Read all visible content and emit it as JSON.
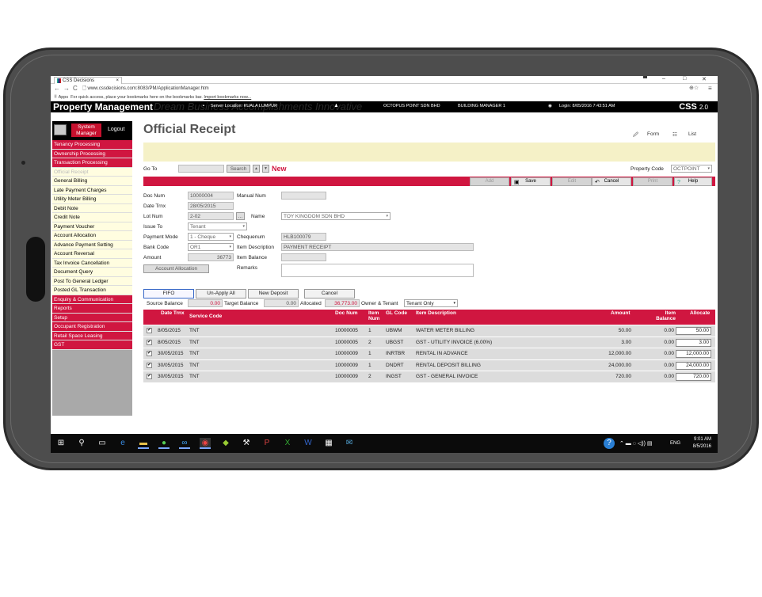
{
  "browser": {
    "tab_title": "CSS Decisions",
    "url": "www.cssdecisions.com:8083/PM/ApplicationManager.htm",
    "bookmarks_apps": "Apps",
    "bookmarks_hint": "For quick access, place your bookmarks here on the bookmarks bar.",
    "bookmarks_link": "Import bookmarks now..."
  },
  "header": {
    "app_title": "Property Management",
    "watermark": "Dream Business Accomplishments Innovative",
    "server_location": "Server Location: KUALA LUMPUR",
    "company": "OCTOPUS POINT SDN BHD",
    "role": "BUILDING MANAGER 1",
    "login": "Login: 8/05/2016 7:43:51 AM",
    "brand": "CSS",
    "version": "2.0"
  },
  "sidebar": {
    "system_manager": "System Manager",
    "logout": "Logout",
    "items": [
      {
        "label": "Tenancy Processing",
        "style": "red"
      },
      {
        "label": "Ownership Processing",
        "style": "red"
      },
      {
        "label": "Transaction Processing",
        "style": "red"
      },
      {
        "label": "Official Receipt",
        "style": "active"
      },
      {
        "label": "General Billing",
        "style": "light"
      },
      {
        "label": "Late Payment Charges",
        "style": "light"
      },
      {
        "label": "Utility Meter Billing",
        "style": "light"
      },
      {
        "label": "Debit Note",
        "style": "light"
      },
      {
        "label": "Credit Note",
        "style": "light"
      },
      {
        "label": "Payment Voucher",
        "style": "light"
      },
      {
        "label": "Account Allocation",
        "style": "light"
      },
      {
        "label": "Advance Payment Setting",
        "style": "light"
      },
      {
        "label": "Account Reversal",
        "style": "light"
      },
      {
        "label": "Tax Invoice Cancellation",
        "style": "light"
      },
      {
        "label": "Document Query",
        "style": "light"
      },
      {
        "label": "Post To General Ledger",
        "style": "light"
      },
      {
        "label": "Posted GL Transaction",
        "style": "light"
      },
      {
        "label": "Enquiry & Communication",
        "style": "red"
      },
      {
        "label": "Reports",
        "style": "red"
      },
      {
        "label": "Setup",
        "style": "red"
      },
      {
        "label": "Occupant Registration",
        "style": "red"
      },
      {
        "label": "Retail Space Leasing",
        "style": "red"
      },
      {
        "label": "GST",
        "style": "red"
      }
    ]
  },
  "page": {
    "title": "Official Receipt",
    "form_link": "Form",
    "list_link": "List",
    "goto_label": "Go To",
    "search_btn": "Search",
    "new_label": "New",
    "property_code_label": "Property Code",
    "property_code": "OCTPOINT"
  },
  "toolbar": {
    "add": "Add",
    "save": "Save",
    "edit": "Edit",
    "cancel": "Cancel",
    "print": "Print",
    "help": "Help"
  },
  "form": {
    "doc_num_label": "Doc Num",
    "doc_num": "10000004",
    "manual_num_label": "Manual Num",
    "manual_num": "",
    "date_label": "Date Trnx",
    "date": "28/05/2015",
    "lot_label": "Lot Num",
    "lot": "2-02",
    "lot_btn": "...",
    "name_label": "Name",
    "name": "TOY KINGDOM SDN BHD",
    "issue_label": "Issue To",
    "issue": "Tenant",
    "mode_label": "Payment Mode",
    "mode": "1 - Cheque",
    "cheque_label": "Chequenum",
    "cheque": "HLB100079",
    "bank_label": "Bank Code",
    "bank": "OR1",
    "desc_label": "Item Description",
    "desc": "PAYMENT RECEIPT",
    "amount_label": "Amount",
    "amount": "36773",
    "balance_label": "Item Balance",
    "balance": "",
    "remarks_label": "Remarks",
    "remarks": "",
    "alloc_btn": "Account Allocation"
  },
  "grid": {
    "fifo": "FIFO",
    "unapply": "Un-Apply All",
    "new_deposit": "New Deposit",
    "cancel": "Cancel",
    "source_label": "Source Balance",
    "source": "0.00",
    "target_label": "Target Balance",
    "target": "0.00",
    "allocated_label": "Allocated",
    "allocated": "36,773.00",
    "owner_label": "Owner & Tenant",
    "owner": "Tenant Only",
    "headers": {
      "date": "Date Trnx",
      "service": "Service Code",
      "doc": "Doc Num",
      "item": "Item Num",
      "gl": "GL Code",
      "desc": "Item Description",
      "amount": "Amount",
      "balance": "Item Balance",
      "alloc": "Allocate"
    },
    "rows": [
      {
        "date": "8/05/2015",
        "service": "TNT",
        "doc": "10000005",
        "item": "1",
        "gl": "UBWM",
        "desc": "WATER METER BILLING",
        "amount": "50.00",
        "balance": "0.00",
        "alloc": "50.00"
      },
      {
        "date": "8/05/2015",
        "service": "TNT",
        "doc": "10000005",
        "item": "2",
        "gl": "UBGST",
        "desc": "GST - UTILITY INVOICE (6.00%)",
        "amount": "3.00",
        "balance": "0.00",
        "alloc": "3.00"
      },
      {
        "date": "30/05/2015",
        "service": "TNT",
        "doc": "10000009",
        "item": "1",
        "gl": "INRTBR",
        "desc": "RENTAL IN ADVANCE",
        "amount": "12,000.00",
        "balance": "0.00",
        "alloc": "12,000.00"
      },
      {
        "date": "30/05/2015",
        "service": "TNT",
        "doc": "10000009",
        "item": "1",
        "gl": "DNDRT",
        "desc": "RENTAL DEPOSIT BILLING",
        "amount": "24,000.00",
        "balance": "0.00",
        "alloc": "24,000.00"
      },
      {
        "date": "30/05/2015",
        "service": "TNT",
        "doc": "10000009",
        "item": "2",
        "gl": "INGST",
        "desc": "GST - GENERAL INVOICE",
        "amount": "720.00",
        "balance": "0.00",
        "alloc": "720.00"
      }
    ]
  },
  "taskbar": {
    "lang": "ENG",
    "time": "9:01 AM",
    "date": "8/5/2016"
  },
  "colors": {
    "accent_red": "#d01640",
    "message_bar": "#f5f1c7",
    "bezel": "#4d4d4d"
  }
}
